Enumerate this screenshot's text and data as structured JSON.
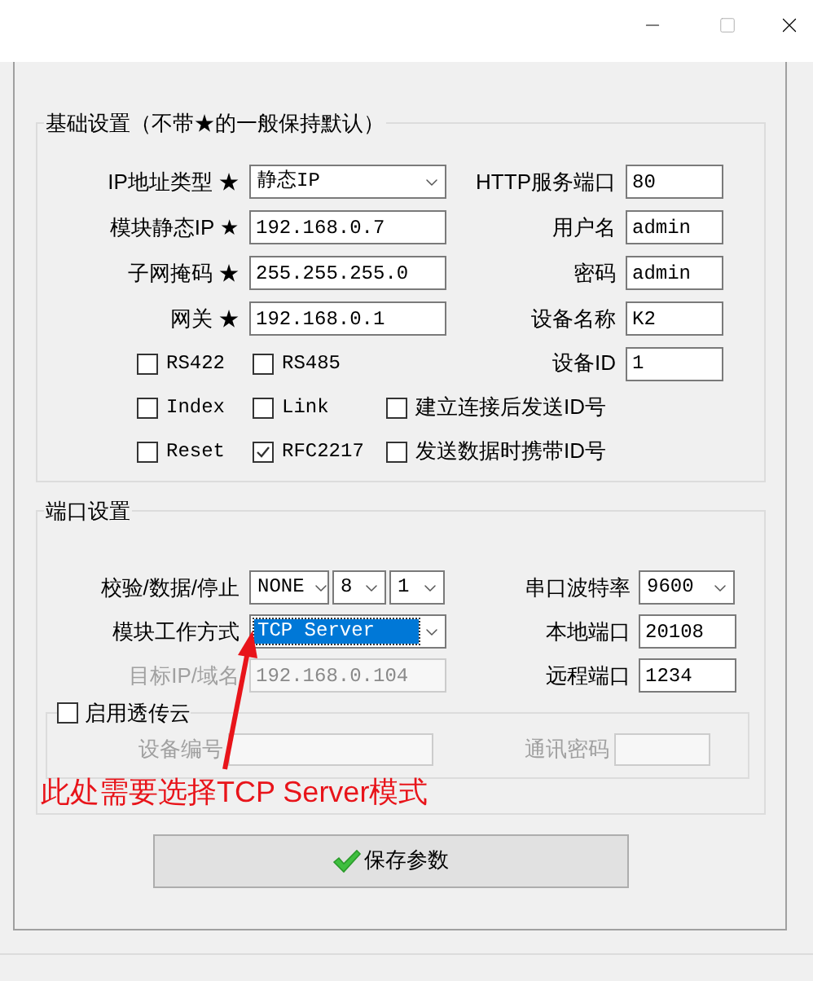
{
  "basic": {
    "title": "基础设置（不带★的一般保持默认）",
    "rows": [
      {
        "label": "IP地址类型 ★",
        "control": {
          "kind": "select",
          "value": "静态IP"
        },
        "right_label": "HTTP服务端口",
        "right_control": {
          "kind": "input",
          "value": "80"
        }
      },
      {
        "label": "模块静态IP ★",
        "control": {
          "kind": "input",
          "value": "192.168.0.7"
        },
        "right_label": "用户名",
        "right_control": {
          "kind": "input",
          "value": "admin"
        }
      },
      {
        "label": "子网掩码 ★",
        "control": {
          "kind": "input",
          "value": "255.255.255.0"
        },
        "right_label": "密码",
        "right_control": {
          "kind": "input",
          "value": "admin"
        }
      },
      {
        "label": "网关 ★",
        "control": {
          "kind": "input",
          "value": "192.168.0.1"
        },
        "right_label": "设备名称",
        "right_control": {
          "kind": "input",
          "value": "K2"
        }
      }
    ],
    "checkbox_rows": [
      {
        "items": [
          {
            "label": "RS422",
            "checked": false
          },
          {
            "label": "RS485",
            "checked": false
          }
        ],
        "right_label": "设备ID",
        "right_control": {
          "kind": "input",
          "value": "1"
        }
      },
      {
        "items": [
          {
            "label": "Index",
            "checked": false
          },
          {
            "label": "Link",
            "checked": false
          },
          {
            "label": "建立连接后发送ID号",
            "checked": false
          }
        ]
      },
      {
        "items": [
          {
            "label": "Reset",
            "checked": false
          },
          {
            "label": "RFC2217",
            "checked": true
          },
          {
            "label": "发送数据时携带ID号",
            "checked": false
          }
        ]
      }
    ]
  },
  "port": {
    "title": "端口设置",
    "rows": [
      {
        "label": "校验/数据/停止",
        "disabled": false,
        "controls": [
          {
            "kind": "select",
            "value": "NONE",
            "disabled": false
          },
          {
            "kind": "select",
            "value": "8",
            "disabled": false
          },
          {
            "kind": "select",
            "value": "1",
            "disabled": false
          }
        ],
        "right_label": "串口波特率",
        "right_control": {
          "kind": "select",
          "value": "9600",
          "disabled": false
        }
      },
      {
        "label": "模块工作方式",
        "disabled": false,
        "controls": [
          {
            "kind": "select",
            "value": "TCP Server",
            "disabled": false,
            "focused": true
          }
        ],
        "right_label": "本地端口",
        "right_control": {
          "kind": "input",
          "value": "20108",
          "disabled": false
        }
      },
      {
        "label": "目标IP/域名",
        "disabled": true,
        "controls": [
          {
            "kind": "input",
            "value": "192.168.0.104",
            "disabled": true
          }
        ],
        "right_label": "远程端口",
        "right_control": {
          "kind": "input",
          "value": "1234",
          "disabled": false
        }
      }
    ],
    "cloud": {
      "label": "启用透传云",
      "checked": false,
      "fields": [
        {
          "label": "设备编号",
          "disabled": true
        },
        {
          "label": "通讯密码",
          "disabled": true
        }
      ]
    }
  },
  "annotation": {
    "text": "此处需要选择TCP Server模式"
  },
  "save_button": {
    "label": "保存参数"
  }
}
